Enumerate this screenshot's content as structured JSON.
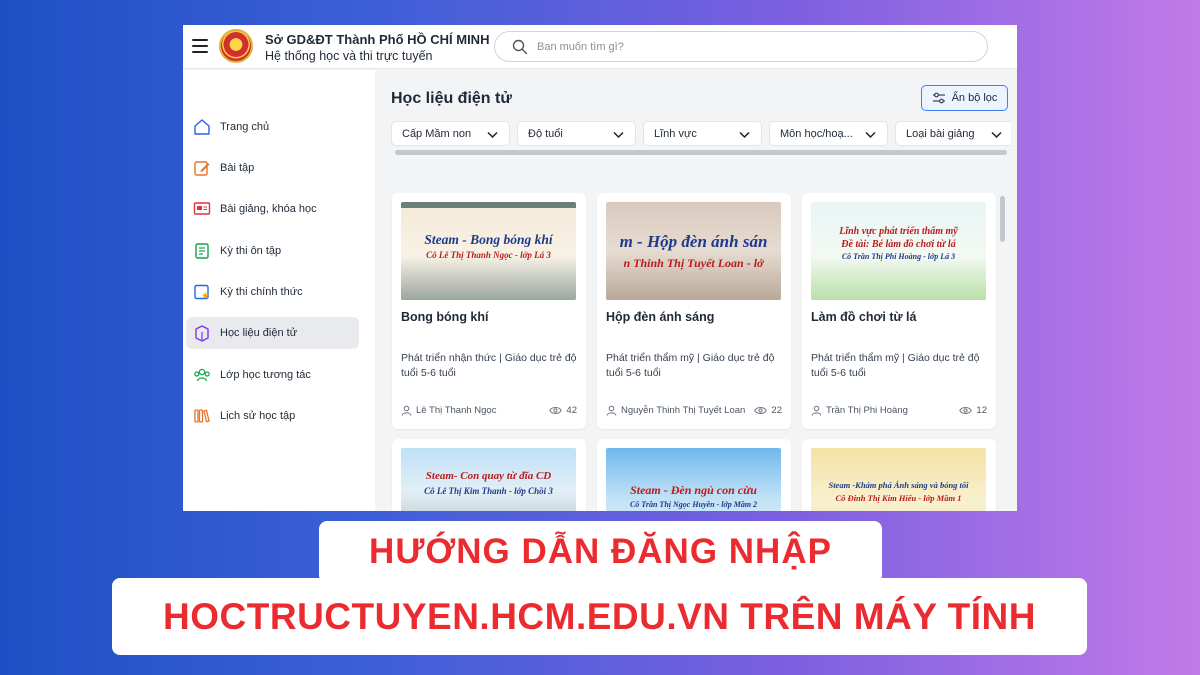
{
  "header": {
    "title": "Sở GD&ĐT Thành Phố HỒ CHÍ MINH",
    "subtitle": "Hệ thống học và thi trực tuyến",
    "search_placeholder": "Ban muốn tìm gì?"
  },
  "sidebar": {
    "items": [
      {
        "label": "Trang chủ",
        "icon": "home-icon"
      },
      {
        "label": "Bài tập",
        "icon": "edit-icon"
      },
      {
        "label": "Bài giảng, khóa học",
        "icon": "lecture-icon"
      },
      {
        "label": "Kỳ thi ôn tập",
        "icon": "exam-review-icon"
      },
      {
        "label": "Kỳ thi chính thức",
        "icon": "exam-official-icon"
      },
      {
        "label": "Học liệu điện tử",
        "icon": "elearning-icon",
        "active": true
      },
      {
        "label": "Lớp học tương tác",
        "icon": "group-icon"
      },
      {
        "label": "Lịch sử học tập",
        "icon": "history-icon"
      }
    ]
  },
  "main": {
    "title": "Học liệu điện tử",
    "filter_button": "Ẩn bộ lọc",
    "filters": [
      "Cấp Mầm non",
      "Độ tuổi",
      "Lĩnh vực",
      "Môn học/hoạ...",
      "Loại bài giảng"
    ],
    "cards": [
      {
        "thumb_line1": "Steam - Bong bóng khí",
        "thumb_line2": "Cô Lê Thị Thanh Ngọc - lớp Lá 3",
        "title": "Bong bóng khí",
        "desc": "Phát triển nhận thức | Giáo dục trẻ độ tuổi 5-6 tuổi",
        "author": "Lê Thị Thanh Ngọc",
        "views": "42"
      },
      {
        "thumb_line1": "m - Hộp đèn ánh sán",
        "thumb_line2": "n Thinh Thị Tuyết Loan - lớ",
        "title": "Hộp đèn ánh sáng",
        "desc": "Phát triển thẩm mỹ | Giáo dục trẻ độ tuổi 5-6 tuổi",
        "author": "Nguyễn Thinh Thị Tuyết Loan",
        "views": "22"
      },
      {
        "thumb_line1": "Lĩnh vực phát triển thẩm mỹ",
        "thumb_line2": "Đề tài: Bé làm đồ chơi từ lá",
        "thumb_line3": "Cô Trần Thị Phi Hoàng - lớp Lá 3",
        "title": "Làm đồ chơi từ lá",
        "desc": "Phát triển thẩm mỹ | Giáo dục trẻ độ tuổi 5-6 tuổi",
        "author": "Trần Thị Phi Hoàng",
        "views": "12"
      },
      {
        "thumb_line1": "Steam- Con quay từ đĩa CD",
        "thumb_line2": "Cô Lê Thị Kim Thanh - lớp Chồi 3"
      },
      {
        "thumb_line1": "Steam - Đèn ngủ con cừu",
        "thumb_line2": "Cô Trần Thị Ngọc Huyền - lớp Mầm 2"
      },
      {
        "thumb_line1": "Steam -Khám phá Ánh sáng và bóng tối",
        "thumb_line2": "Cô Đinh Thị Kim Hiếu - lớp Mầm 1"
      }
    ]
  },
  "banner": {
    "line1": "HƯỚNG DẪN ĐĂNG NHẬP",
    "line2": "HOCTRUCTUYEN.HCM.EDU.VN TRÊN MÁY TÍNH"
  },
  "colors": {
    "accent": "#3b82f6",
    "banner_text": "#ea2b2f"
  }
}
